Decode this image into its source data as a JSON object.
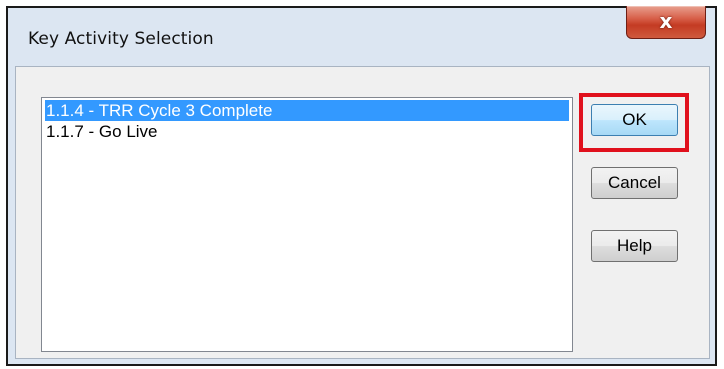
{
  "dialog": {
    "title": "Key Activity Selection",
    "close_glyph": "x"
  },
  "activity_list": {
    "items": [
      {
        "label": "1.1.4 - TRR Cycle 3 Complete",
        "selected": true
      },
      {
        "label": "1.1.7 - Go Live",
        "selected": false
      }
    ]
  },
  "buttons": {
    "ok_label": "OK",
    "cancel_label": "Cancel",
    "help_label": "Help"
  },
  "colors": {
    "selection": "#3399ff",
    "highlight_frame": "#e0101c",
    "close_button": "#c43b23",
    "dialog_frame": "#dce6f2"
  },
  "icons": {
    "close": "close-icon"
  }
}
